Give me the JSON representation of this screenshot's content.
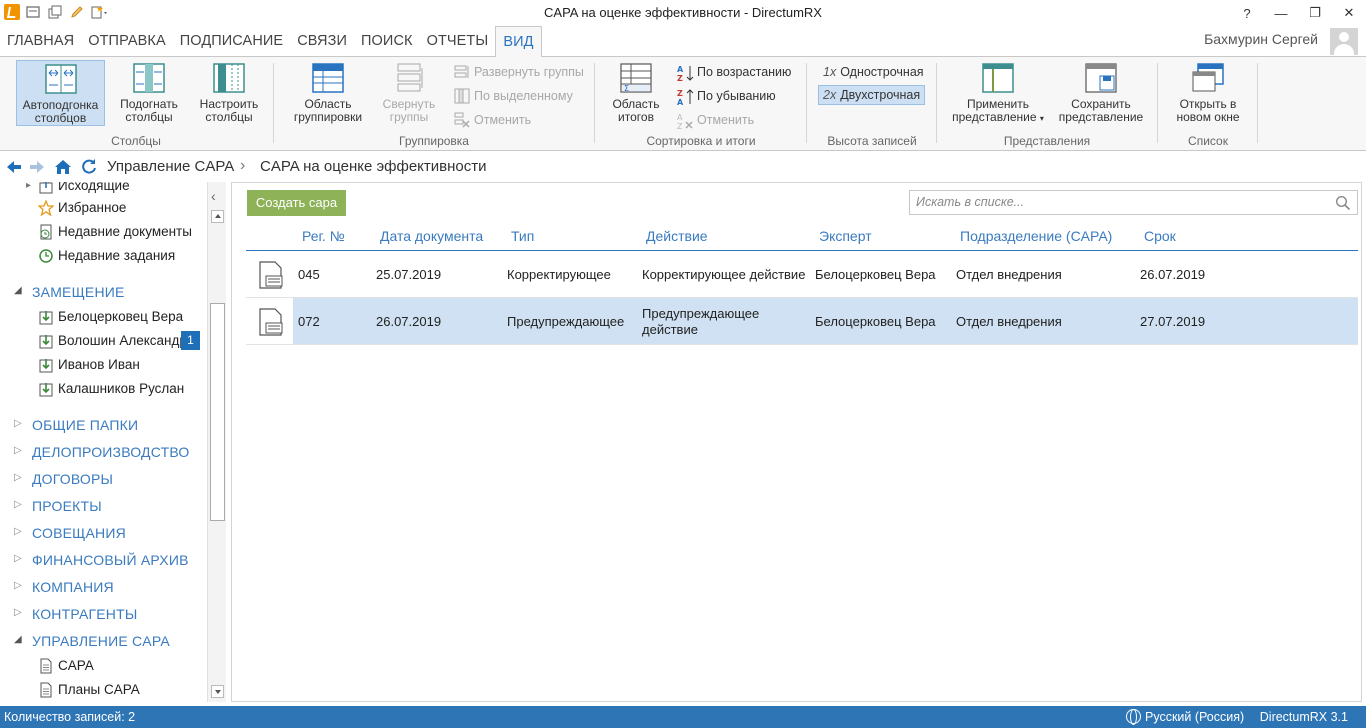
{
  "window": {
    "title": "CAPA на оценке эффективности - DirectumRX",
    "help": "?",
    "minimize": "—",
    "restore": "❐",
    "close": "✕"
  },
  "menu": {
    "tabs": [
      "ГЛАВНАЯ",
      "ОТПРАВКА",
      "ПОДПИСАНИЕ",
      "СВЯЗИ",
      "ПОИСК",
      "ОТЧЕТЫ",
      "ВИД"
    ],
    "active_tab": "ВИД",
    "user_name": "Бахмурин Сергей"
  },
  "ribbon": {
    "columns": {
      "label": "Столбцы",
      "autofit": "Автоподгонка столбцов",
      "fit": "Подогнать столбцы",
      "configure": "Настроить столбцы"
    },
    "grouping": {
      "label": "Группировка",
      "area": "Область группировки",
      "collapse": "Свернуть группы",
      "expand": "Развернуть группы",
      "by_selected": "По выделенному",
      "cancel": "Отменить"
    },
    "sorting": {
      "label": "Сортировка и итоги",
      "totals_area": "Область итогов",
      "ascending": "По возрастанию",
      "descending": "По убыванию",
      "cancel": "Отменить"
    },
    "row_height": {
      "label": "Высота записей",
      "single": "Однострочная",
      "single_prefix": "1x",
      "double": "Двухстрочная",
      "double_prefix": "2x"
    },
    "views": {
      "label": "Представления",
      "apply": "Применить представление",
      "save": "Сохранить представление"
    },
    "list": {
      "label": "Список",
      "open_new": "Открыть в новом окне"
    }
  },
  "breadcrumb": [
    "Управление CAPA",
    "CAPA на оценке эффективности"
  ],
  "sidebar": {
    "top_items": [
      {
        "label": "Исходящие",
        "icon": "outbox-icon"
      },
      {
        "label": "Избранное",
        "icon": "star-icon"
      },
      {
        "label": "Недавние документы",
        "icon": "recent-docs-icon"
      },
      {
        "label": "Недавние задания",
        "icon": "recent-tasks-icon"
      }
    ],
    "substitution_section": "ЗАМЕЩЕНИЕ",
    "substitution_items": [
      {
        "label": "Белоцерковец Вера",
        "badge": ""
      },
      {
        "label": "Волошин Александр",
        "badge": "1"
      },
      {
        "label": "Иванов Иван",
        "badge": ""
      },
      {
        "label": "Калашников Руслан",
        "badge": ""
      }
    ],
    "sections": [
      "ОБЩИЕ ПАПКИ",
      "ДЕЛОПРОИЗВОДСТВО",
      "ДОГОВОРЫ",
      "ПРОЕКТЫ",
      "СОВЕЩАНИЯ",
      "ФИНАНСОВЫЙ АРХИВ",
      "КОМПАНИЯ",
      "КОНТРАГЕНТЫ"
    ],
    "capa_section": "УПРАВЛЕНИЕ CAPA",
    "capa_items": [
      "CAPA",
      "Планы CAPA"
    ]
  },
  "list": {
    "create_button": "Создать capa",
    "search_placeholder": "Искать в списке...",
    "columns": [
      "Рег. №",
      "Дата документа",
      "Тип",
      "Действие",
      "Эксперт",
      "Подразделение (CAPA)",
      "Срок"
    ],
    "rows": [
      {
        "reg": "045",
        "date": "25.07.2019",
        "type": "Корректирующее",
        "action": "Корректирующее действие",
        "expert": "Белоцерковец Вера",
        "dept": "Отдел внедрения",
        "due": "26.07.2019",
        "selected": false
      },
      {
        "reg": "072",
        "date": "26.07.2019",
        "type": "Предупреждающее",
        "action": "Предупреждающее действие",
        "expert": "Белоцерковец Вера",
        "dept": "Отдел внедрения",
        "due": "27.07.2019",
        "selected": true
      }
    ]
  },
  "status": {
    "count": "Количество записей: 2",
    "language": "Русский (Россия)",
    "version": "DirectumRX 3.1"
  },
  "colors": {
    "accent": "#2a73c1",
    "create_button": "#8db257",
    "status_bar": "#2e75b6",
    "selection": "#cfe1f2"
  }
}
